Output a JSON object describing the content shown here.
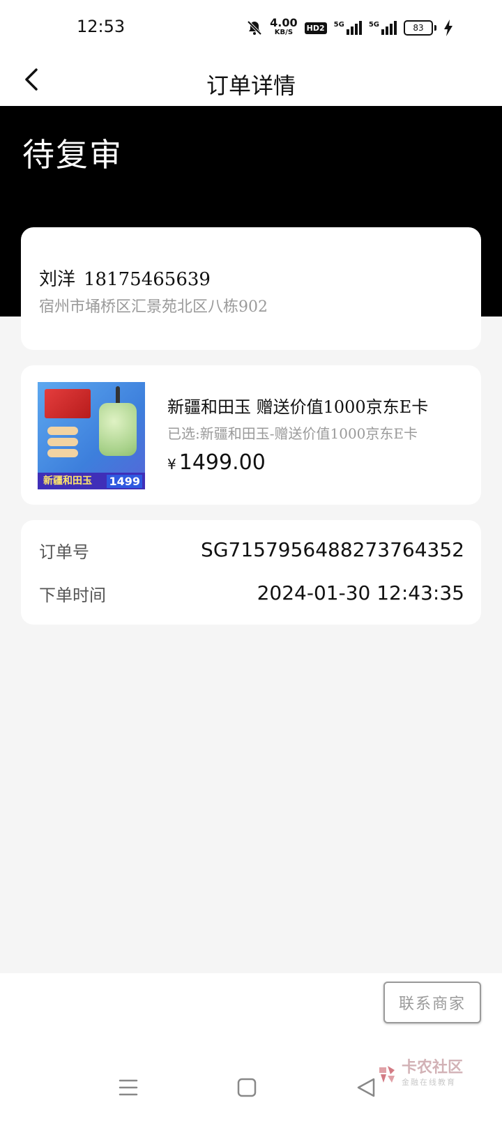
{
  "status_bar": {
    "time": "12:53",
    "net_speed_value": "4.00",
    "net_speed_unit": "KB/S",
    "hd_badge": "HD2",
    "signal1_label": "5G",
    "signal2_label": "5G",
    "battery": "83",
    "icons": [
      "bell-off-icon",
      "signal-icon",
      "signal-icon",
      "battery-icon",
      "charging-icon"
    ]
  },
  "nav": {
    "title": "订单详情",
    "back_icon": "chevron-left-icon"
  },
  "order": {
    "status": "待复审",
    "address": {
      "name": "刘洋",
      "phone": "18175465639",
      "line": "宿州市埇桥区汇景苑北区八栋902"
    },
    "product": {
      "title": "新疆和田玉 赠送价值1000京东E卡",
      "selection": "已选:新疆和田玉-赠送价值1000京东E卡",
      "currency": "¥",
      "price": "1499.00",
      "image_caption": "新疆和田玉",
      "image_price": "1499"
    },
    "info": {
      "order_no_label": "订单号",
      "order_no": "SG7157956488273764352",
      "time_label": "下单时间",
      "time": "2024-01-30 12:43:35"
    }
  },
  "footer": {
    "contact_label": "联系商家",
    "watermark_main": "卡农社区",
    "watermark_sub": "金融在线教育"
  },
  "system_nav": {
    "icons": [
      "menu-icon",
      "home-square-icon",
      "back-triangle-icon"
    ]
  },
  "colors": {
    "banner_bg": "#000000",
    "page_bg": "#f5f5f5",
    "muted_text": "#9a9a9a"
  }
}
